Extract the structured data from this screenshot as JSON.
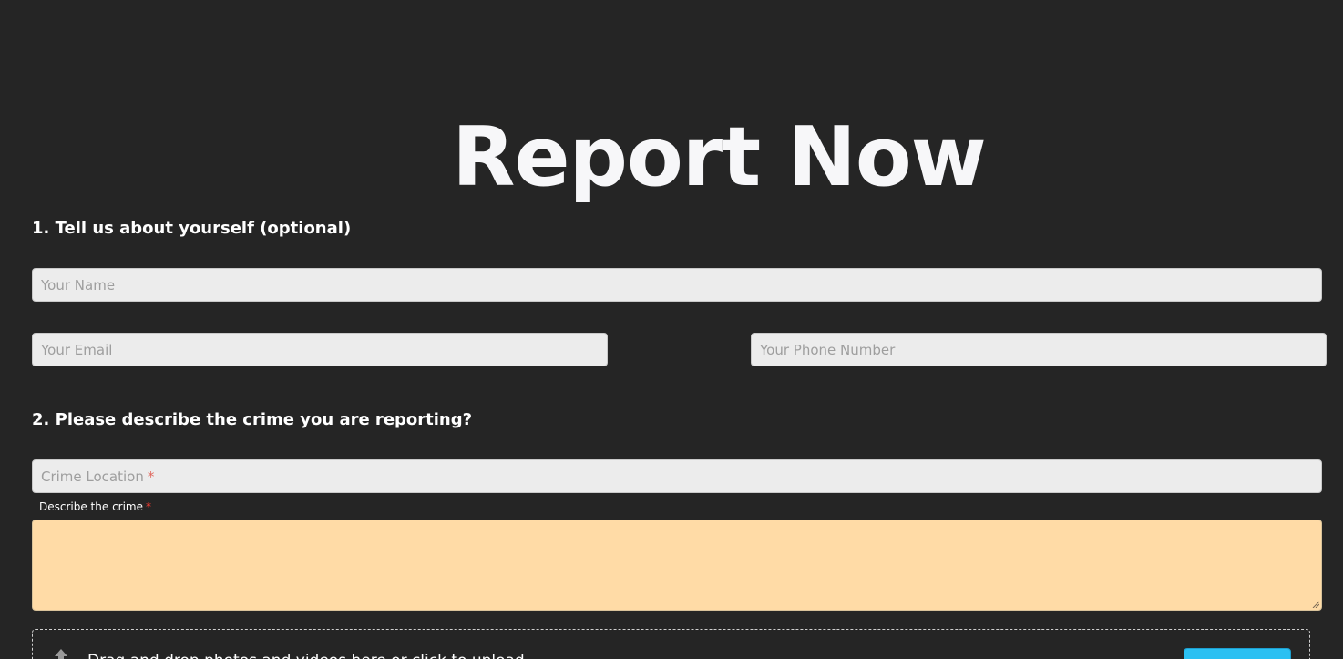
{
  "page": {
    "title": "Report Now"
  },
  "section1": {
    "heading": "1. Tell us about yourself (optional)",
    "name_placeholder": "Your Name",
    "email_placeholder": "Your Email",
    "phone_placeholder": "Your Phone Number"
  },
  "section2": {
    "heading": "2. Please describe the crime you are reporting?",
    "location_placeholder": "Crime Location",
    "required_marker": "*",
    "description_label": "Describe the crime",
    "description_value": ""
  },
  "upload": {
    "prompt": "Drag and drop photos and videos here or click to upload",
    "icon": "upload-arrow-icon",
    "button_label": ""
  },
  "colors": {
    "background": "#252525",
    "input_background": "#ececec",
    "textarea_background": "#ffdba6",
    "required": "#ff3b30",
    "button": "#2bc0f2"
  }
}
